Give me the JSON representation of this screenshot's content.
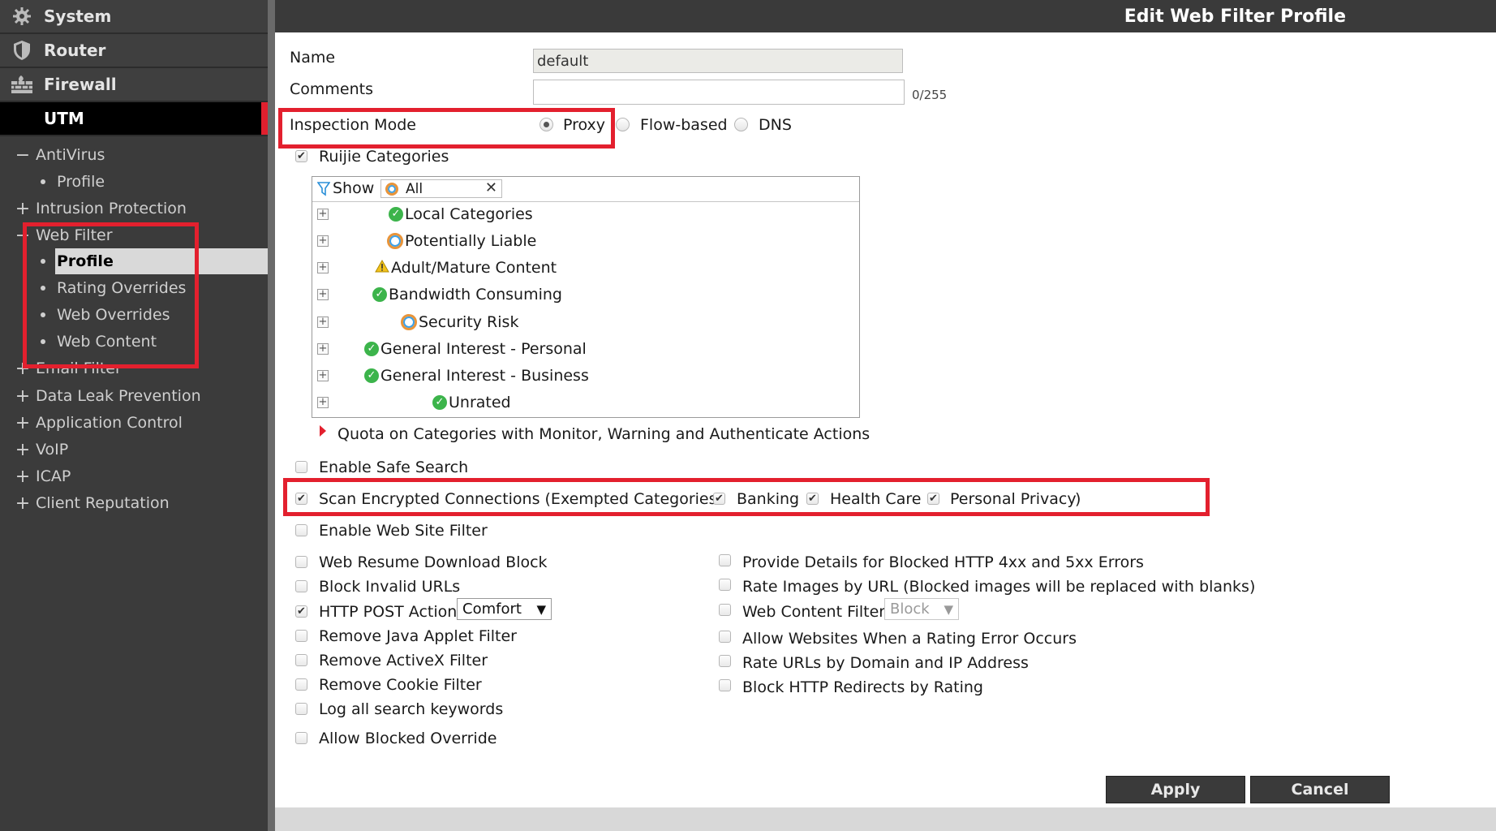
{
  "sidebar": {
    "top_items": [
      {
        "label": "System",
        "icon": "gear-icon"
      },
      {
        "label": "Router",
        "icon": "shield-icon"
      },
      {
        "label": "Firewall",
        "icon": "firewall-icon"
      },
      {
        "label": "UTM",
        "icon": ""
      }
    ],
    "tree": {
      "antivirus": "AntiVirus",
      "antivirus_profile": "Profile",
      "intrusion": "Intrusion Protection",
      "webfilter": "Web Filter",
      "wf_profile": "Profile",
      "wf_rating": "Rating Overrides",
      "wf_overrides": "Web Overrides",
      "wf_content": "Web Content",
      "email": "Email Filter",
      "dlp": "Data Leak Prevention",
      "appctrl": "Application Control",
      "voip": "VoIP",
      "icap": "ICAP",
      "client_rep": "Client Reputation"
    }
  },
  "header": {
    "title": "Edit Web Filter Profile"
  },
  "form": {
    "name_label": "Name",
    "name_value": "default",
    "comments_label": "Comments",
    "comments_value": "",
    "comments_counter": "0/255",
    "inspection_label": "Inspection Mode",
    "inspection_options": [
      "Proxy",
      "Flow-based",
      "DNS"
    ],
    "inspection_selected": "Proxy",
    "categories_label": "Ruijie Categories",
    "show_label": "Show",
    "show_filter": "All",
    "categories": [
      {
        "name": "Local Categories",
        "icon": "check-icon"
      },
      {
        "name": "Potentially Liable",
        "icon": "ring-icon"
      },
      {
        "name": "Adult/Mature Content",
        "icon": "warning-icon"
      },
      {
        "name": "Bandwidth Consuming",
        "icon": "check-icon"
      },
      {
        "name": "Security Risk",
        "icon": "ring-icon"
      },
      {
        "name": "General Interest - Personal",
        "icon": "check-icon"
      },
      {
        "name": "General Interest - Business",
        "icon": "check-icon"
      },
      {
        "name": "Unrated",
        "icon": "check-icon"
      }
    ],
    "quota_label": "Quota on Categories with Monitor, Warning and Authenticate Actions",
    "safe_search": "Enable Safe Search",
    "scan_encrypted": "Scan Encrypted Connections (Exempted Categories:",
    "banking": "Banking",
    "health_care": "Health Care",
    "personal_privacy": "Personal Privacy",
    "close_paren": ")",
    "web_site_filter": "Enable Web Site Filter",
    "left_options": {
      "resume": "Web Resume Download Block",
      "invalid_urls": "Block Invalid URLs",
      "post_action": "HTTP POST Action",
      "post_action_value": "Comfort",
      "java": "Remove Java Applet Filter",
      "activex": "Remove ActiveX Filter",
      "cookie": "Remove Cookie Filter",
      "log_search": "Log all search keywords",
      "blocked_override": "Allow Blocked Override"
    },
    "right_options": {
      "details": "Provide Details for Blocked HTTP 4xx and 5xx Errors",
      "rate_images": "Rate Images by URL (Blocked images will be replaced with blanks)",
      "content_filter": "Web Content Filter",
      "content_filter_value": "Block",
      "rating_error": "Allow Websites When a Rating Error Occurs",
      "rate_domain": "Rate URLs by Domain and IP Address",
      "redirects": "Block HTTP Redirects by Rating"
    }
  },
  "buttons": {
    "apply": "Apply",
    "cancel": "Cancel"
  },
  "colors": {
    "highlight_box": "#e3202e",
    "sidebar_bg": "#3b3b3b",
    "header_bg": "#3a3a3a"
  }
}
